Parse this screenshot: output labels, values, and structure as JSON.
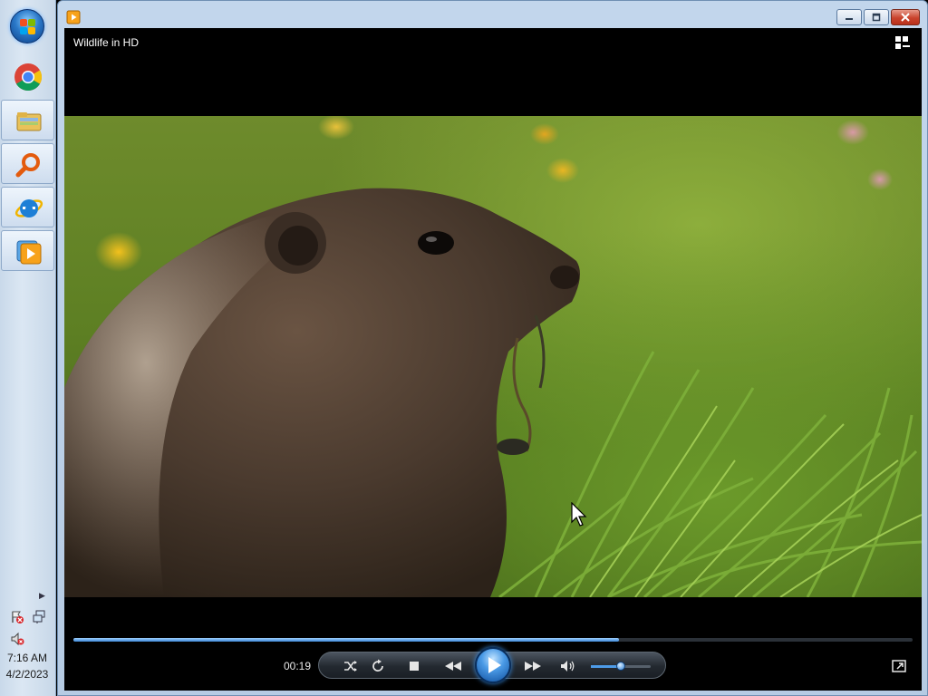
{
  "taskbar": {
    "start_label": "Start",
    "pinned": [
      {
        "name": "chrome",
        "icon": "chrome-icon"
      },
      {
        "name": "file-explorer",
        "icon": "folder-icon"
      },
      {
        "name": "search",
        "icon": "magnifier-icon"
      },
      {
        "name": "internet-explorer",
        "icon": "ie-icon"
      },
      {
        "name": "media-player",
        "icon": "media-player-icon"
      }
    ],
    "tray": {
      "icons": [
        "action-center-error-icon",
        "network-icon",
        "volume-muted-icon"
      ]
    },
    "clock": {
      "time": "7:16 AM",
      "date": "4/2/2023"
    }
  },
  "window": {
    "app_icon": "media-player-icon",
    "controls": [
      "minimize",
      "maximize",
      "close"
    ]
  },
  "player": {
    "video_title": "Wildlife in HD",
    "elapsed": "00:19",
    "progress": 0.65,
    "volume": 0.5,
    "buttons": [
      "shuffle",
      "repeat",
      "stop",
      "previous",
      "play",
      "next",
      "mute"
    ]
  },
  "colors": {
    "accent": "#3c87d6",
    "taskbar": "#dbe7f3",
    "player_bg": "#000000"
  }
}
